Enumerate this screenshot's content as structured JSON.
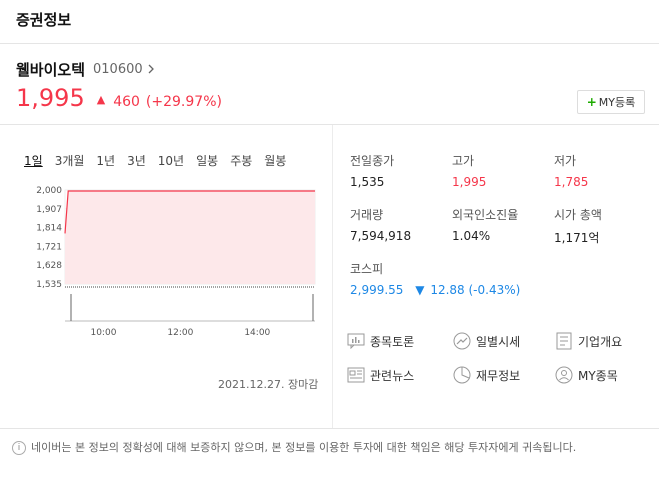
{
  "header": {
    "title": "증권정보"
  },
  "stock": {
    "name": "웰바이오텍",
    "code": "010600",
    "price": "1,995",
    "change_arrow": "▲",
    "change": "460",
    "change_pct": "(+29.97%)"
  },
  "my_button": {
    "plus": "+",
    "label": "MY등록"
  },
  "tabs": [
    {
      "label": "1일",
      "active": true
    },
    {
      "label": "3개월"
    },
    {
      "label": "1년"
    },
    {
      "label": "3년"
    },
    {
      "label": "10년"
    },
    {
      "label": "일봉"
    },
    {
      "label": "주봉"
    },
    {
      "label": "월봉"
    }
  ],
  "chart_data": {
    "type": "area",
    "y_ticks": [
      "2,000",
      "1,907",
      "1,814",
      "1,721",
      "1,628",
      "1,535"
    ],
    "x_ticks": [
      "10:00",
      "12:00",
      "14:00"
    ],
    "ylim": [
      1535,
      2000
    ],
    "x": [
      "09:00",
      "09:05",
      "15:30"
    ],
    "values": [
      1785,
      1995,
      1995
    ],
    "base_value": 1535,
    "line_color": "#f5364a",
    "fill_color": "#fde8ea"
  },
  "chart_date": "2021.12.27. 장마감",
  "info": {
    "prev_close": {
      "label": "전일종가",
      "value": "1,535"
    },
    "high": {
      "label": "고가",
      "value": "1,995"
    },
    "low": {
      "label": "저가",
      "value": "1,785"
    },
    "volume": {
      "label": "거래량",
      "value": "7,594,918"
    },
    "foreign": {
      "label": "외국인소진율",
      "value": "1.04%"
    },
    "market_cap": {
      "label": "시가 총액",
      "value": "1,171억"
    },
    "kospi": {
      "label": "코스피",
      "value": "2,999.55",
      "arrow": "▼",
      "change": "12.88 (-0.43%)"
    }
  },
  "links": {
    "discussion": "종목토론",
    "daily": "일별시세",
    "company": "기업개요",
    "news": "관련뉴스",
    "finance": "재무정보",
    "my_stocks": "MY종목"
  },
  "footer": {
    "icon": "i",
    "text": "네이버는 본 정보의 정확성에 대해 보증하지 않으며, 본 정보를 이용한 투자에 대한 책임은 해당 투자자에게 귀속됩니다."
  }
}
